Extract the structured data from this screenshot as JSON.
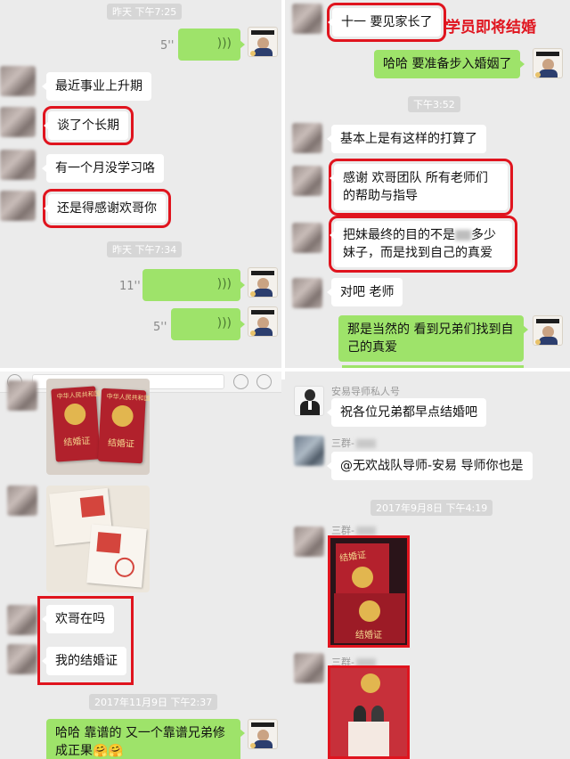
{
  "top_left": {
    "timestamp_1": "昨天 下午7:25",
    "voice_1_duration": "5''",
    "messages": [
      {
        "text": "最近事业上升期"
      },
      {
        "text": "谈了个长期"
      },
      {
        "text": "有一个月没学习咯"
      },
      {
        "text": "还是得感谢欢哥你"
      }
    ],
    "timestamp_2": "昨天 下午7:34",
    "voice_2_duration": "11''",
    "voice_3_duration": "5''"
  },
  "top_right": {
    "message_1": "十一 要见家长了",
    "annotation": "学员即将结婚",
    "reply_1": "哈哈 要准备步入婚姻了",
    "timestamp": "下午3:52",
    "messages": [
      {
        "text": "基本上是有这样的打算了"
      },
      {
        "text": "感谢 欢哥团队 所有老师们的帮助与指导"
      },
      {
        "text_before": "把妹最终的目的不是",
        "text_after": "多少妹子，而是找到自己的真爱"
      },
      {
        "text": "对吧 老师"
      }
    ],
    "reply_2": "那是当然的 看到兄弟们找到自己的真爱"
  },
  "bottom_left": {
    "cert_label": "结婚证",
    "cert_country": "中华人民共和国",
    "messages": [
      {
        "text": "欢哥在吗"
      },
      {
        "text": "我的结婚证"
      }
    ],
    "timestamp": "2017年11月9日 下午2:37",
    "reply": "哈哈 靠谱的 又一个靠谱兄弟修成正果🤗🤗"
  },
  "bottom_right": {
    "sender_1": "安易导师私人号",
    "message_1": "祝各位兄弟都早点结婚吧",
    "sender_2": "三群-",
    "message_2": "@无欢战队导师-安易 导师你也是",
    "timestamp": "2017年9月8日 下午4:19",
    "sender_3": "三群-",
    "sender_4": "三群-",
    "cert_label": "结婚证"
  },
  "colors": {
    "highlight": "#e0141e",
    "bubble_green": "#9ee36a",
    "bubble_white": "#ffffff",
    "background": "#ebebeb"
  }
}
